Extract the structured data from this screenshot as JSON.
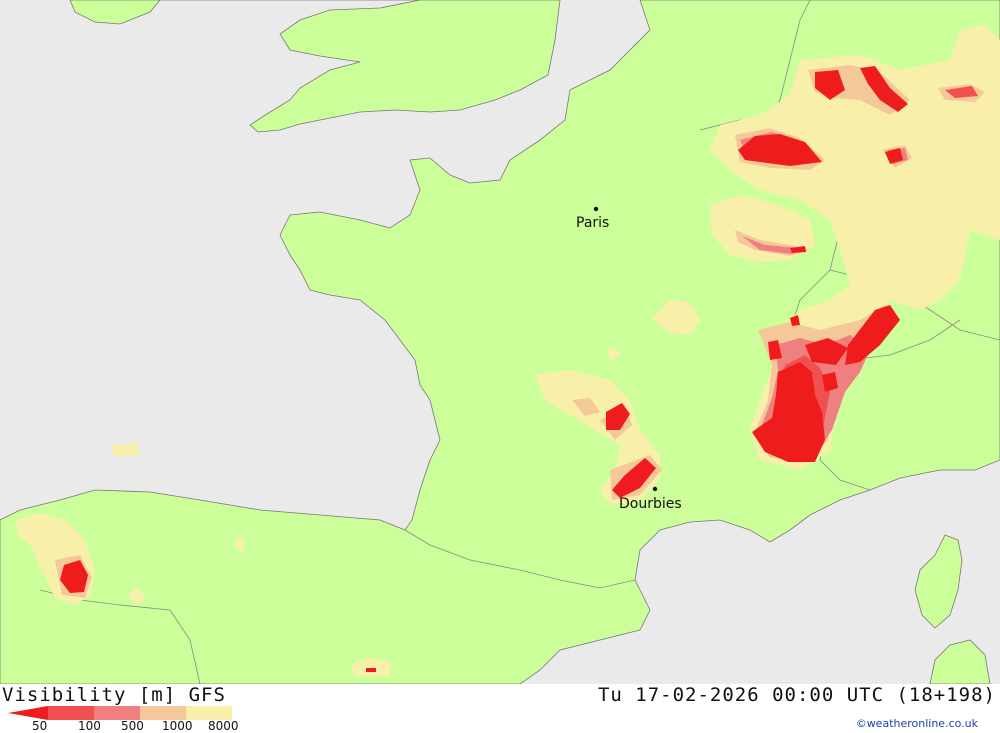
{
  "map": {
    "colors": {
      "sea": "#eaeaea",
      "land": "#ccff99",
      "vis_8000": "#f8f0aa",
      "vis_1000": "#f5c89a",
      "vis_500": "#f08080",
      "vis_100": "#f05050",
      "vis_50": "#ee1c1c",
      "coastline": "#777777",
      "border": "#888888"
    },
    "cities": [
      {
        "name": "Paris"
      },
      {
        "name": "Dourbies"
      }
    ]
  },
  "footer": {
    "title": "Visibility [m] GFS",
    "datetime": "Tu 17-02-2026 00:00 UTC (18+198)",
    "credit": "©weatheronline.co.uk",
    "legend": {
      "labels": [
        "50",
        "100",
        "500",
        "1000",
        "8000"
      ],
      "colors": [
        "#ee1c1c",
        "#f05050",
        "#f08080",
        "#f5c89a",
        "#f8f0aa"
      ]
    }
  }
}
